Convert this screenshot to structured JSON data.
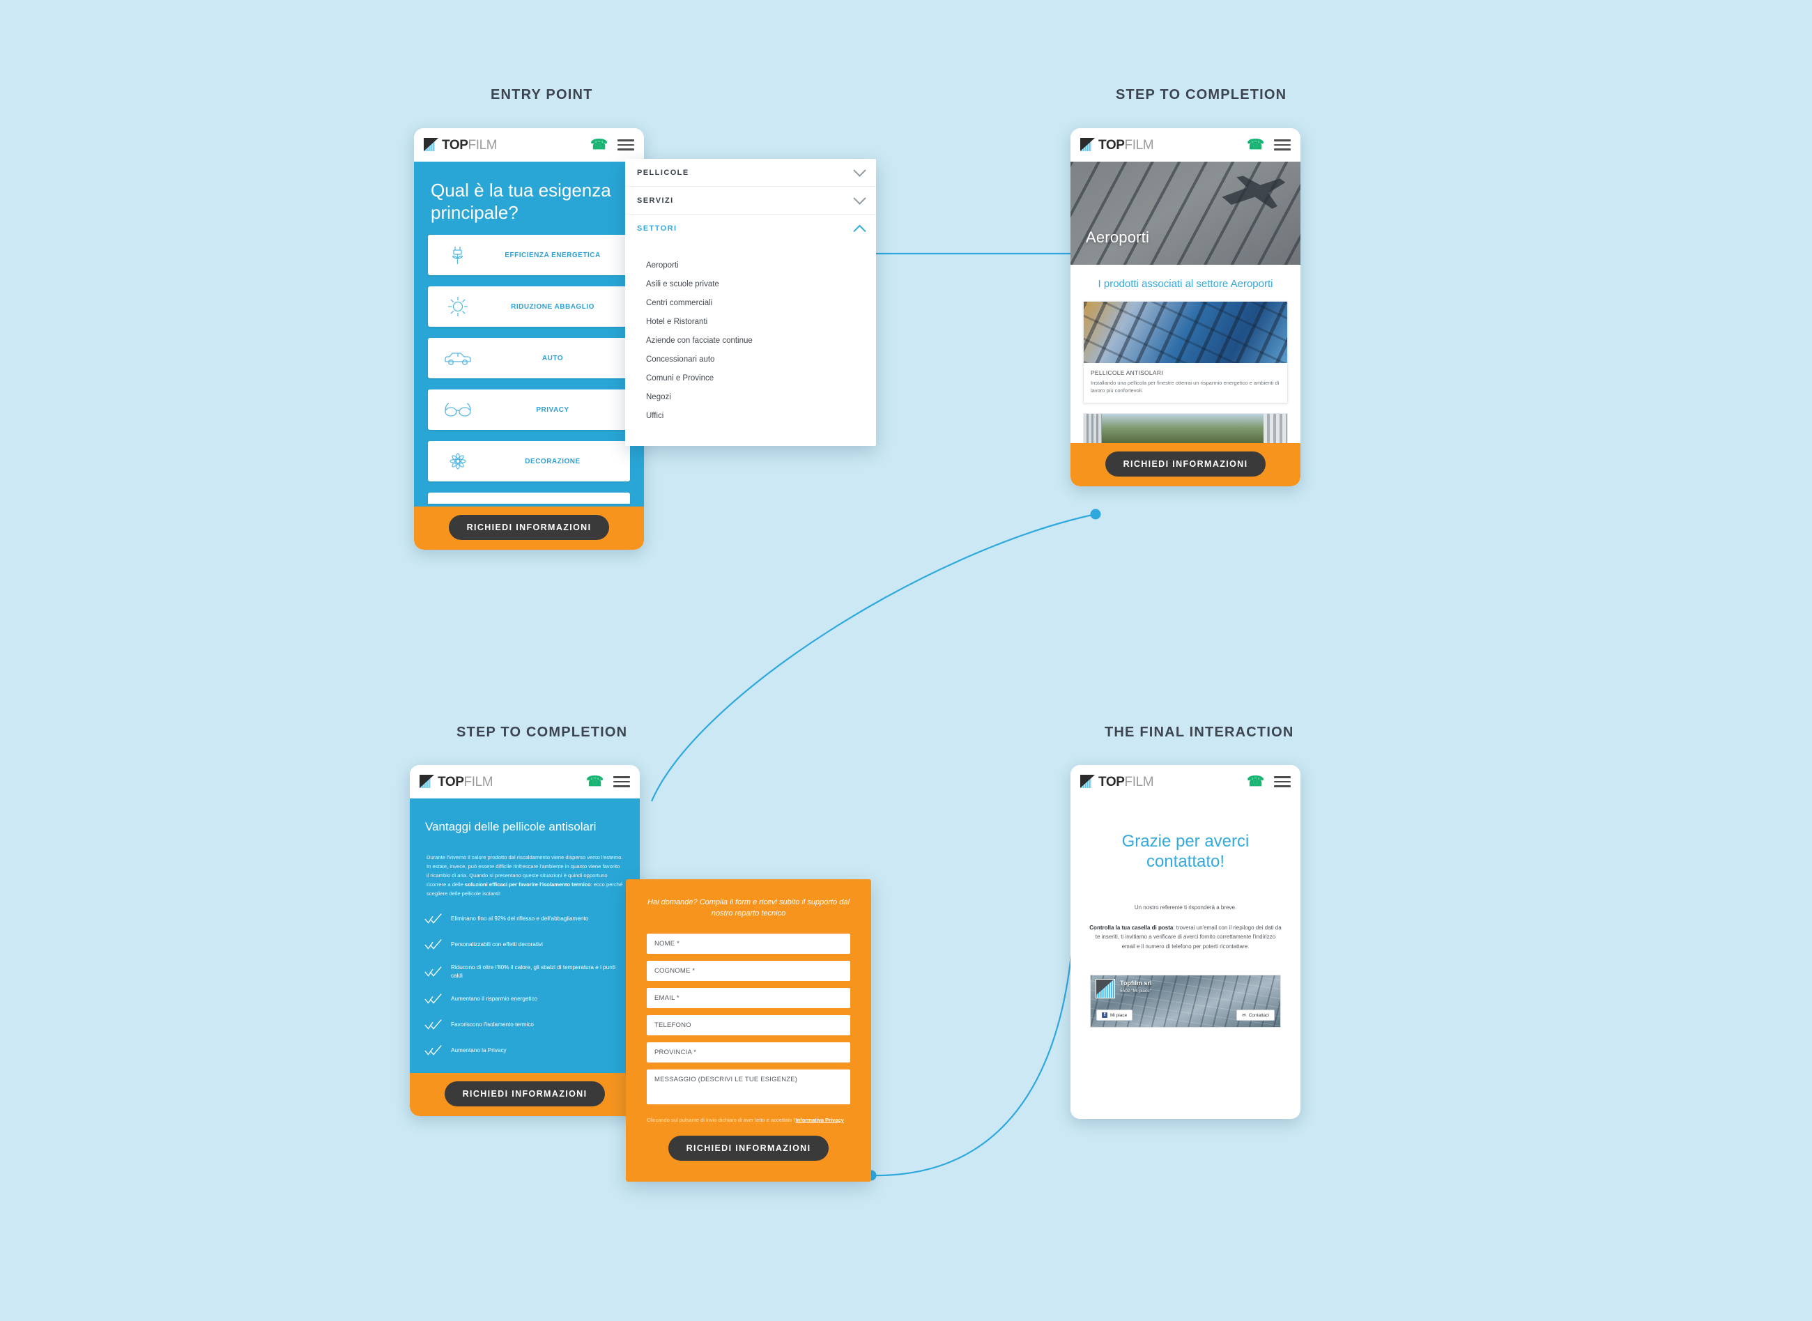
{
  "colors": {
    "background": "#cbe8f4",
    "brand_blue": "#29a6d6",
    "accent_cyan": "#34aadc",
    "orange": "#f7941e",
    "dark_button": "#3a3a3a",
    "green_phone": "#18b473",
    "connector": "#2ea8dd"
  },
  "flow_labels": {
    "entry_point": "ENTRY POINT",
    "step_to_completion_top": "STEP TO COMPLETION",
    "step_to_completion_bottom": "STEP TO COMPLETION",
    "final_interaction": "THE FINAL INTERACTION"
  },
  "brand": {
    "logo_top": "TOP",
    "logo_film": "FILM",
    "phone_icon": "phone-icon",
    "menu_icon": "hamburger-menu-icon"
  },
  "screen1": {
    "headline": "Qual è la tua esigenza principale?",
    "categories": [
      {
        "label": "EFFICIENZA ENERGETICA",
        "icon": "plug-plant-icon"
      },
      {
        "label": "RIDUZIONE ABBAGLIO",
        "icon": "sun-icon"
      },
      {
        "label": "AUTO",
        "icon": "car-icon"
      },
      {
        "label": "PRIVACY",
        "icon": "glasses-icon"
      },
      {
        "label": "DECORAZIONE",
        "icon": "flower-icon"
      }
    ],
    "cta": "RICHIEDI INFORMAZIONI"
  },
  "menu": {
    "sections": [
      {
        "label": "PELLICOLE",
        "state": "collapsed",
        "icon": "chevron-down-icon"
      },
      {
        "label": "SERVIZI",
        "state": "collapsed",
        "icon": "chevron-down-icon"
      },
      {
        "label": "SETTORI",
        "state": "expanded",
        "icon": "chevron-up-icon"
      }
    ],
    "settori_items": [
      "Aeroporti",
      "Asili e scuole private",
      "Centri commerciali",
      "Hotel e Ristoranti",
      "Aziende con facciate continue",
      "Concessionari auto",
      "Comuni e Province",
      "Negozi",
      "Uffici"
    ],
    "selected_item": "Aeroporti"
  },
  "screen2": {
    "hero_title": "Aeroporti",
    "hero_image": "airplane-over-glass-building",
    "section_title": "I prodotti associati al settore Aeroporti",
    "product": {
      "image": "glass-facade-sunlight",
      "title": "PELLICOLE ANTISOLARI",
      "description": "Installando una pellicola per finestre otterrai un risparmio energetico e ambienti di lavoro più confortevoli."
    },
    "second_product_image": "landscape-window-view",
    "cta": "RICHIEDI INFORMAZIONI"
  },
  "screen3": {
    "title": "Vantaggi delle pellicole antisolari",
    "paragraph_part1": "Durante l'inverno il calore prodotto dal riscaldamento viene disperso verso l'esterno. In estate, invece, può essere difficile rinfrescare l'ambiente in quanto viene favorito il ricambio di aria. Quando si presentano queste situazioni è quindi opportuno ricorrere a delle ",
    "paragraph_bold": "soluzioni efficaci per favorire l'isolamento termico",
    "paragraph_part2": ": ecco perché scegliere delle pellicole isolanti!",
    "benefits": [
      "Eliminano fino al 92% del riflesso e dell'abbagliamento",
      "Personalizzabili con effetti decorativi",
      "Riducono di oltre l'80% il calore, gli sbalzi di temperatura e i punti caldi",
      "Aumentano il risparmio energetico",
      "Favoriscono l'isolamento termico",
      "Aumentano la Privacy"
    ],
    "benefit_icon": "double-check-icon",
    "cta": "RICHIEDI INFORMAZIONI"
  },
  "form": {
    "lead": "Hai domande? Compila il form e ricevi subito il supporto dal nostro reparto tecnico",
    "fields": [
      {
        "name": "nome",
        "placeholder": "NOME *"
      },
      {
        "name": "cognome",
        "placeholder": "COGNOME *"
      },
      {
        "name": "email",
        "placeholder": "EMAIL *"
      },
      {
        "name": "telefono",
        "placeholder": "TELEFONO"
      },
      {
        "name": "provincia",
        "placeholder": "PROVINCIA *"
      }
    ],
    "message_placeholder": "MESSAGGIO (DESCRIVI LE TUE ESIGENZE)",
    "privacy_text": "Cliccando sul pulsante di invio dichiaro di aver letto e accettato l'",
    "privacy_link": "Informativa Privacy",
    "submit": "RICHIEDI INFORMAZIONI"
  },
  "screen4": {
    "title": "Grazie per averci contattato!",
    "lead": "Un nostro referente ti risponderà a breve.",
    "note_bold": "Controlla la tua casella di posta",
    "note_rest": ": troverai un'email con il riepilogo dei dati da te inseriti, ti invitiamo a verificare di averci fornito correttamente l'indirizzo email e il numero di telefono per poterti ricontattare.",
    "facebook": {
      "page_name": "Topfilm srl",
      "likes": "5502 \"Mi piace\"",
      "like_button": "Mi piace",
      "contact_button": "Contattaci",
      "like_icon": "facebook-icon",
      "contact_icon": "envelope-icon",
      "cover_image": "glass-office-building"
    }
  }
}
